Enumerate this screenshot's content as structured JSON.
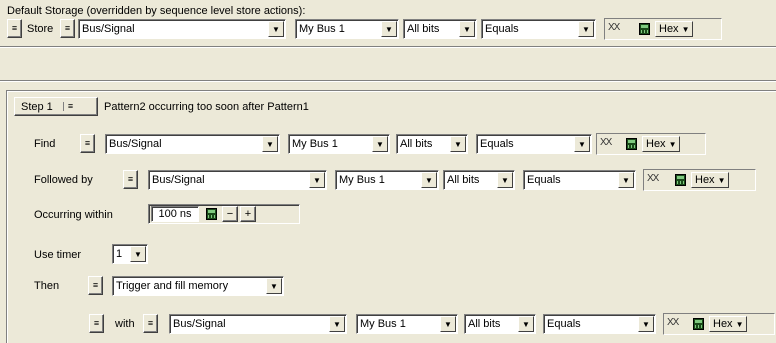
{
  "default_storage": {
    "label": "Default Storage (overridden by sequence level store actions):",
    "action_label": "Store",
    "signal": "Bus/Signal",
    "bus": "My Bus 1",
    "bits": "All bits",
    "operator": "Equals",
    "value": "XX",
    "radix": "Hex"
  },
  "step": {
    "button_label": "Step 1",
    "description": "Pattern2 occurring too soon after Pattern1",
    "find": {
      "label": "Find",
      "signal": "Bus/Signal",
      "bus": "My Bus 1",
      "bits": "All bits",
      "operator": "Equals",
      "value": "XX",
      "radix": "Hex"
    },
    "followed_by": {
      "label": "Followed by",
      "signal": "Bus/Signal",
      "bus": "My Bus 1",
      "bits": "All bits",
      "operator": "Equals",
      "value": "XX",
      "radix": "Hex"
    },
    "occurring_within": {
      "label": "Occurring within",
      "value": "100 ns",
      "minus": "−",
      "plus": "+"
    },
    "use_timer": {
      "label": "Use timer",
      "value": "1"
    },
    "then": {
      "label": "Then",
      "action": "Trigger and fill memory"
    },
    "with": {
      "label": "with",
      "signal": "Bus/Signal",
      "bus": "My Bus 1",
      "bits": "All bits",
      "operator": "Equals",
      "value": "XX",
      "radix": "Hex"
    }
  },
  "icons": {
    "chevron": "double-chevron-down-icon",
    "dropdown": "triangle-down-icon",
    "calculator": "calculator-icon"
  }
}
